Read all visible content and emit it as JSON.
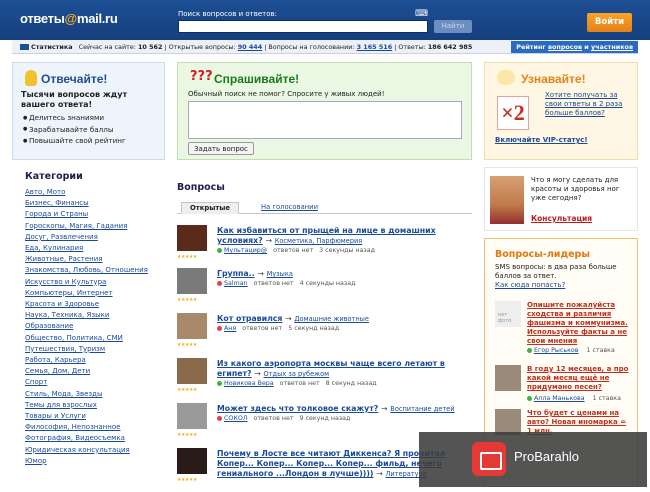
{
  "header": {
    "logo_left": "ответы",
    "logo_at": "@",
    "logo_right": "mail.ru",
    "search_label": "Поиск вопросов и ответов:",
    "search_value": "",
    "search_button": "Найти",
    "login_button": "Войти"
  },
  "stats": {
    "title": "Статистика",
    "online_label": "Сейчас на сайте:",
    "online_value": "10 562",
    "open_label": "Открытые вопросы:",
    "open_value": "90 444",
    "vote_label": "Вопросы на голосовании:",
    "vote_value": "3 165 516",
    "answers_label": "Ответы:",
    "answers_value": "186 642 985",
    "rating_prefix": "Рейтинг",
    "rating_questions": "вопросов",
    "rating_and": "и",
    "rating_users": "участников"
  },
  "answer_panel": {
    "title": "Отвечайте!",
    "subtitle": "Тысячи вопросов ждут вашего ответа!",
    "items": [
      "Делитесь знаниями",
      "Зарабатывайте баллы",
      "Повышайте свой рейтинг"
    ]
  },
  "ask_panel": {
    "title": "Спрашивайте!",
    "hint": "Обычный поиск не помог? Спросите у живых людей!",
    "textarea_value": "",
    "button": "Задать вопрос"
  },
  "learn_panel": {
    "title": "Узнавайте!",
    "badge": "×2",
    "text": "Хотите получать за свои ответы в 2 раза больше баллов?",
    "vip": "Включайте VIP-статус!"
  },
  "categories": {
    "title": "Категории",
    "items": [
      "Авто, Мото",
      "Бизнес, Финансы",
      "Города и Страны",
      "Гороскопы, Магия, Гадания",
      "Досуг, Развлечения",
      "Еда, Кулинария",
      "Животные, Растения",
      "Знакомства, Любовь, Отношения",
      "Искусство и Культура",
      "Компьютеры, Интернет",
      "Красота и Здоровье",
      "Наука, Техника, Языки",
      "Образование",
      "Общество, Политика, СМИ",
      "Путешествия, Туризм",
      "Работа, Карьера",
      "Семья, Дом, Дети",
      "Спорт",
      "Стиль, Мода, Звезды",
      "Темы для взрослых",
      "Товары и Услуги",
      "Философия, Непознанное",
      "Фотография, Видеосъемка",
      "Юридическая консультация",
      "Юмор"
    ]
  },
  "questions": {
    "title": "Вопросы",
    "tab_open": "Открытые",
    "tab_vote": "На голосовании",
    "items": [
      {
        "title": "Как избавиться от прыщей на лице в домашних условиях?",
        "category": "Косметика, Парфюмерия",
        "user": "Мультацир@",
        "answers": "ответов нет",
        "time": "3 секунды назад",
        "dot": "#3cb43c"
      },
      {
        "title": "Группа..",
        "category": "Музыка",
        "user": "Salman",
        "answers": "ответов нет",
        "time": "4 секунды назад",
        "dot": "#e04444"
      },
      {
        "title": "Кот отравился",
        "category": "Домашние животные",
        "user": "Аня",
        "answers": "ответов нет",
        "time": "5 секунд назад",
        "dot": "#e04444"
      },
      {
        "title": "Из какого аэропорта москвы чаще всего летают в египет?",
        "category": "Отдых за рубежом",
        "user": "Новикова Вера",
        "answers": "ответов нет",
        "time": "8 секунд назад",
        "dot": "#3cb43c"
      },
      {
        "title": "Может здесь что толковое скажут?",
        "category": "Воспитание детей",
        "user": "СОКОЛ",
        "answers": "ответов нет",
        "time": "9 секунд назад",
        "dot": "#e04444"
      },
      {
        "title": "Почему в Лосте все читают Диккенса? Я прочитал Копер... Копер... Копер... Копер... фильд, нечего гениального ...Лондон в лучше))))",
        "category": "Литература",
        "user": "",
        "answers": "",
        "time": "",
        "dot": "#3cb43c"
      }
    ],
    "arrow": "→"
  },
  "expert": {
    "question": "Что я могу сделать для красоты и здоровья ног уже сегодня?",
    "link": "Консультация"
  },
  "leaders": {
    "title": "Вопросы-лидеры",
    "subtitle": "SMS вопросы: в два раза больше баллов за ответ.",
    "how": "Как сюда попасть?",
    "photo_placeholder": "нет фото",
    "items": [
      {
        "title": "Опишите пожалуйста сходства и различия фашизма и коммунизма. Используйте факты а не свои мнения",
        "user": "Егор Рыськов",
        "stars": "1 ставка"
      },
      {
        "title": "В году 12 месяцев, а про какой месяц ещё не придумано песен?",
        "user": "Алла Манькова",
        "stars": "1 ставка"
      },
      {
        "title": "Что будет с ценами на авто? Новая иномарка = 1 млн.",
        "user": "",
        "stars": ""
      }
    ]
  },
  "ad": {
    "text": "ProBarahlo"
  }
}
